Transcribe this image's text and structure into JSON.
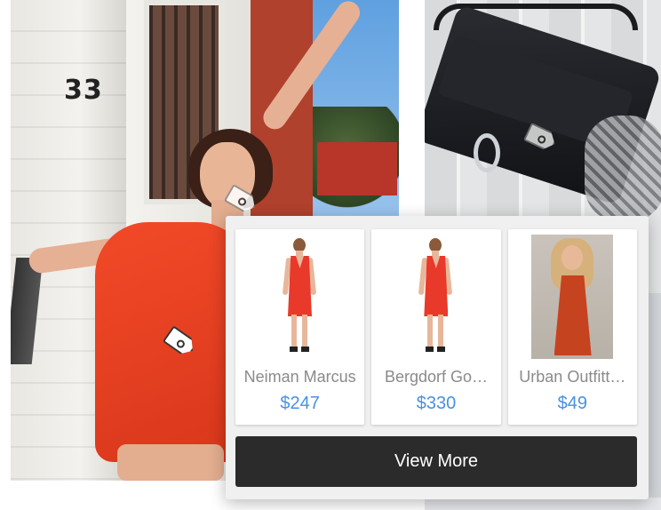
{
  "scene": {
    "house_number": "33"
  },
  "results": [
    {
      "store": "Neiman Marcus",
      "price": "$247",
      "image": "red-dress-model-front"
    },
    {
      "store": "Bergdorf Go…",
      "price": "$330",
      "image": "red-dress-model-front"
    },
    {
      "store": "Urban Outfitt…",
      "price": "$49",
      "image": "red-dress-model-photo"
    }
  ],
  "actions": {
    "view_more_label": "View More"
  },
  "colors": {
    "price": "#4a90e2",
    "button_bg": "#2b2b2b",
    "store_text": "#8a8a8a"
  }
}
